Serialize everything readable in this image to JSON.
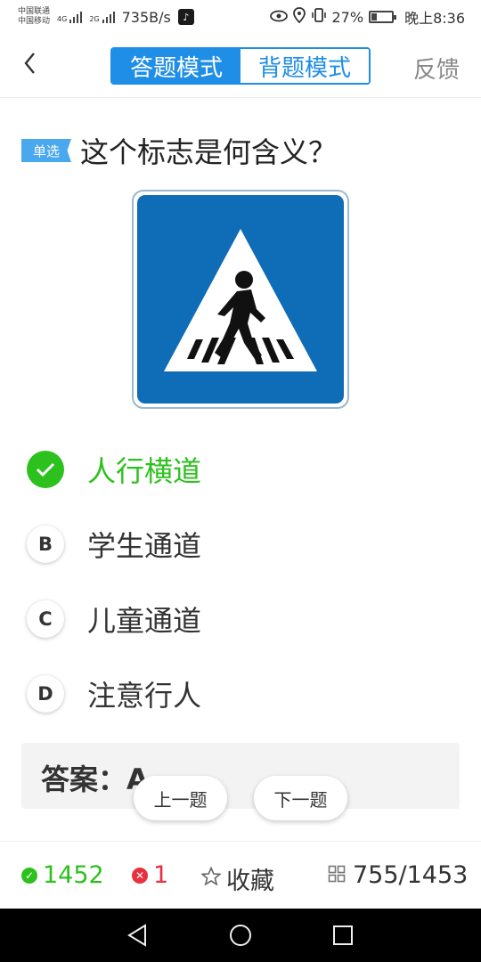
{
  "status_bar": {
    "carrier_1": "中国联通",
    "carrier_2": "中国移动",
    "net_1": "4G",
    "net_2": "2G",
    "speed": "735B/s",
    "battery": "27%",
    "time": "晚上8:36"
  },
  "nav": {
    "back_icon": "chevron-left-icon",
    "mode_answer": "答题模式",
    "mode_memorize": "背题模式",
    "feedback": "反馈"
  },
  "question": {
    "type_tag": "单选",
    "text": "这个标志是何含义？",
    "image": "pedestrian-crossing-sign"
  },
  "options": [
    {
      "letter": "A",
      "text": "人行横道",
      "state": "correct"
    },
    {
      "letter": "B",
      "text": "学生通道",
      "state": "normal"
    },
    {
      "letter": "C",
      "text": "儿童通道",
      "state": "normal"
    },
    {
      "letter": "D",
      "text": "注意行人",
      "state": "normal"
    }
  ],
  "answer": {
    "label": "答案：A"
  },
  "pager": {
    "prev": "上一题",
    "next": "下一题"
  },
  "stats": {
    "correct_count": "1452",
    "wrong_count": "1",
    "favorite": "收藏",
    "progress": "755/1453"
  },
  "colors": {
    "primary": "#1f8ee6",
    "correct": "#2dc11e",
    "wrong": "#e8303f"
  }
}
